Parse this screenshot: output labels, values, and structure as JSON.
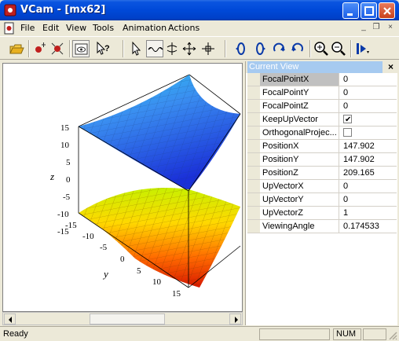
{
  "window": {
    "title": "VCam - [mx62]"
  },
  "menu": [
    "File",
    "Edit",
    "View",
    "Tools",
    "Animation",
    "Actions"
  ],
  "mdi_controls": [
    "_",
    "❐",
    "×"
  ],
  "plot": {
    "axis_label_z": "z",
    "axis_label_y": "y",
    "z_ticks": [
      "15",
      "10",
      "5",
      "0",
      "-5",
      "-10",
      "-15"
    ],
    "y_ticks": [
      "-15",
      "-10",
      "-5",
      "0",
      "5",
      "10",
      "15"
    ]
  },
  "panel": {
    "title": "Current View",
    "close": "×",
    "properties": [
      {
        "name": "FocalPointX",
        "value": "0"
      },
      {
        "name": "FocalPointY",
        "value": "0"
      },
      {
        "name": "FocalPointZ",
        "value": "0"
      },
      {
        "name": "KeepUpVector",
        "value": "✔"
      },
      {
        "name": "OrthogonalProjec...",
        "value": ""
      },
      {
        "name": "PositionX",
        "value": "147.902"
      },
      {
        "name": "PositionY",
        "value": "147.902"
      },
      {
        "name": "PositionZ",
        "value": "209.165"
      },
      {
        "name": "UpVectorX",
        "value": "0"
      },
      {
        "name": "UpVectorY",
        "value": "0"
      },
      {
        "name": "UpVectorZ",
        "value": "1"
      },
      {
        "name": "ViewingAngle",
        "value": "0.174533"
      }
    ]
  },
  "status": {
    "text": "Ready",
    "num": "NUM"
  },
  "colors": {
    "title_bar": "#0049d8",
    "panel_title": "#a6caf0",
    "chrome": "#ece9d8"
  }
}
